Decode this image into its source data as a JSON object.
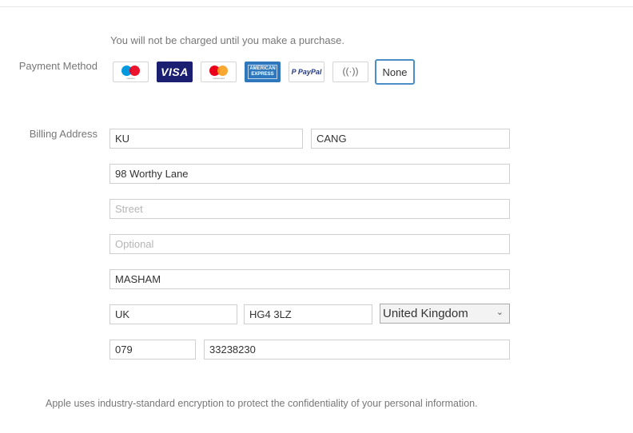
{
  "notice": "You will not be charged until you make a purchase.",
  "payment_method_label": "Payment Method",
  "billing_address_label": "Billing Address",
  "payment_options": [
    {
      "name": "Maestro",
      "icon": "maestro-card-icon",
      "caption": "maestro"
    },
    {
      "name": "VISA",
      "icon": "visa-card-icon",
      "caption": "VISA"
    },
    {
      "name": "Mastercard",
      "icon": "mastercard-card-icon",
      "caption": "mastercard"
    },
    {
      "name": "American Express",
      "icon": "amex-card-icon",
      "caption": "AMERICAN EXPRESS"
    },
    {
      "name": "PayPal",
      "icon": "paypal-icon",
      "caption": "PayPal"
    },
    {
      "name": "Contactless",
      "icon": "contactless-icon",
      "caption": "((·))"
    },
    {
      "name": "None",
      "selected": true,
      "caption": "None"
    }
  ],
  "billing": {
    "first_name": {
      "value": "KU"
    },
    "last_name": {
      "value": "CANG"
    },
    "street1": {
      "value": "98 Worthy Lane"
    },
    "street2": {
      "value": "",
      "placeholder": "Street"
    },
    "street3": {
      "value": "",
      "placeholder": "Optional"
    },
    "city": {
      "value": "MASHAM"
    },
    "county": {
      "value": "UK"
    },
    "postcode": {
      "value": "HG4 3LZ"
    },
    "country": {
      "selected": "United Kingdom"
    },
    "phone_area": {
      "value": "079"
    },
    "phone_number": {
      "value": "33238230"
    }
  },
  "footer_text": "Apple uses industry-standard encryption to protect the confidentiality of your personal information.",
  "colors": {
    "accent": "#4b8ec5",
    "visa": "#1a1f71",
    "amex": "#2e77bc",
    "mc_red": "#eb001b",
    "mc_orange": "#f79e1b",
    "maestro_blue": "#0099df"
  }
}
